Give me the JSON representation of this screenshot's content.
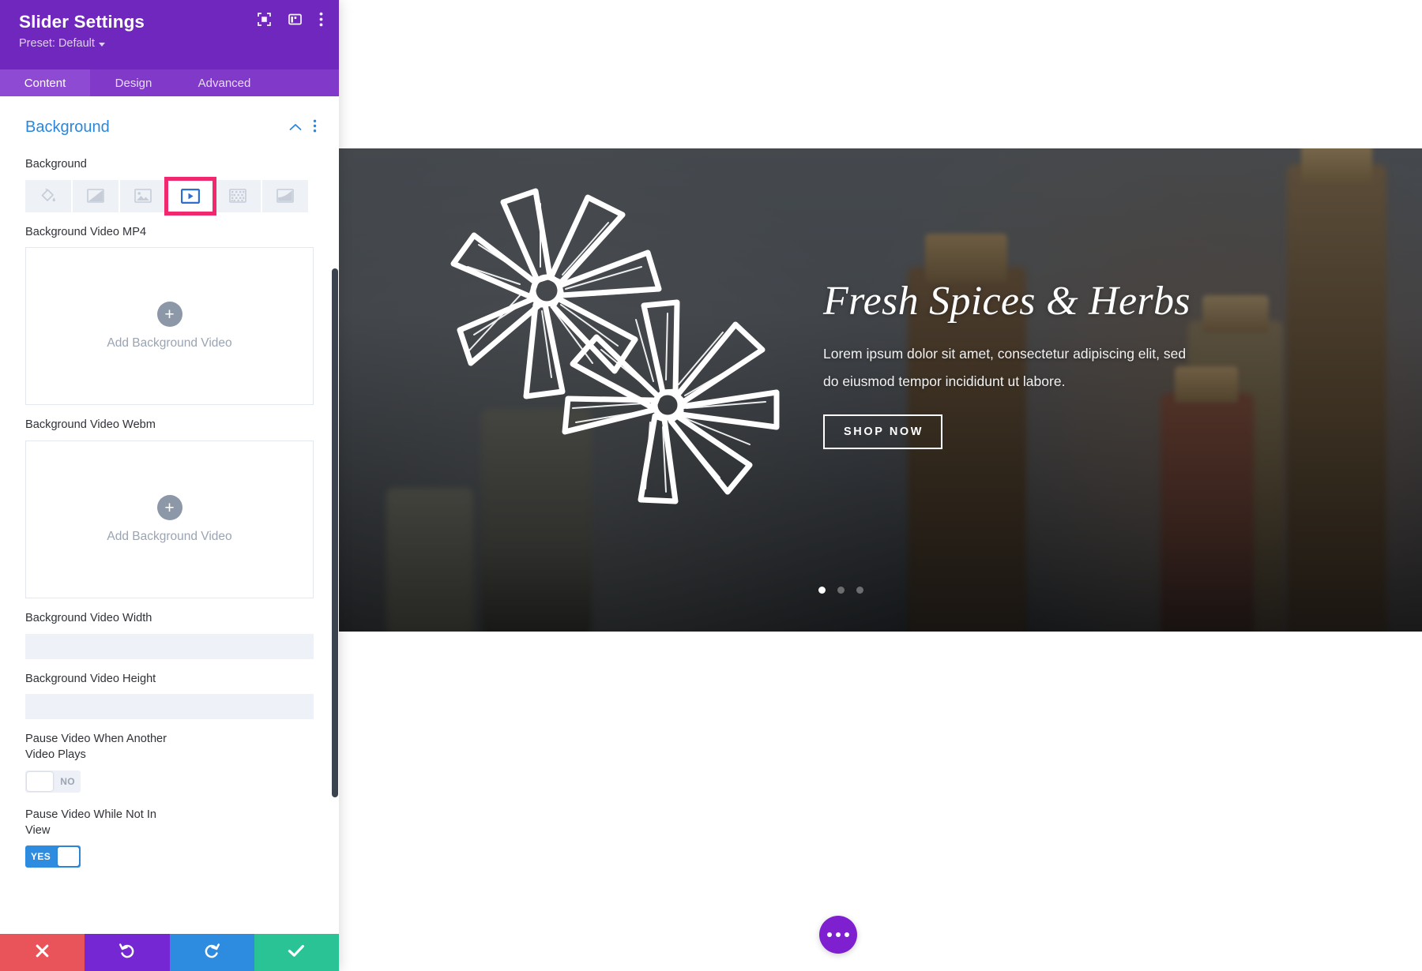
{
  "panel": {
    "title": "Slider Settings",
    "preset_label": "Preset: Default",
    "header_icons": [
      {
        "name": "focus-target-icon",
        "label": "Focus Module"
      },
      {
        "name": "panel-layout-icon",
        "label": "Panel Layout"
      },
      {
        "name": "more-vertical-icon",
        "label": "More Options"
      }
    ],
    "tabs": [
      {
        "label": "Content",
        "active": true
      },
      {
        "label": "Design",
        "active": false
      },
      {
        "label": "Advanced",
        "active": false
      }
    ],
    "section": {
      "title": "Background",
      "collapse_icon": "chevron-up-icon",
      "menu_icon": "more-vertical-icon"
    },
    "background_field": {
      "label": "Background",
      "selected_index": 3,
      "selected_color": "#f0286d",
      "active_icon_color": "#2d6fd0",
      "options": [
        {
          "name": "background-color-icon",
          "label": "Background Color"
        },
        {
          "name": "background-gradient-icon",
          "label": "Background Gradient"
        },
        {
          "name": "background-image-icon",
          "label": "Background Image"
        },
        {
          "name": "background-video-icon",
          "label": "Background Video"
        },
        {
          "name": "background-pattern-icon",
          "label": "Background Pattern"
        },
        {
          "name": "background-mask-icon",
          "label": "Background Mask"
        }
      ]
    },
    "fields": {
      "video_mp4_label": "Background Video MP4",
      "video_mp4_dropzone": "Add Background Video",
      "video_webm_label": "Background Video Webm",
      "video_webm_dropzone": "Add Background Video",
      "video_width_label": "Background Video Width",
      "video_width_value": "",
      "video_width_placeholder": "",
      "video_height_label": "Background Video Height",
      "video_height_value": "",
      "video_height_placeholder": "",
      "pause_other_label": "Pause Video When Another Video Plays",
      "pause_other_state": "NO",
      "pause_not_in_view_label": "Pause Video While Not In View",
      "pause_not_in_view_state": "YES"
    },
    "footer": [
      {
        "name": "cancel-button",
        "icon": "close-icon",
        "color": "#e9545a"
      },
      {
        "name": "undo-button",
        "icon": "undo-icon",
        "color": "#7627d4"
      },
      {
        "name": "redo-button",
        "icon": "redo-icon",
        "color": "#2d8ce0"
      },
      {
        "name": "save-button",
        "icon": "check-icon",
        "color": "#29c396"
      }
    ]
  },
  "canvas": {
    "hero": {
      "heading": "Fresh Spices & Herbs",
      "paragraph": "Lorem ipsum dolor sit amet, consectetur adipiscing elit, sed do eiusmod tempor incididunt ut labore.",
      "cta_label": "SHOP NOW",
      "illustration": "star-anise-line-art",
      "slides": 3,
      "active_slide": 1
    },
    "fab": {
      "name": "page-settings-fab",
      "icon": "ellipsis-icon",
      "color": "#7e1fd0"
    }
  }
}
